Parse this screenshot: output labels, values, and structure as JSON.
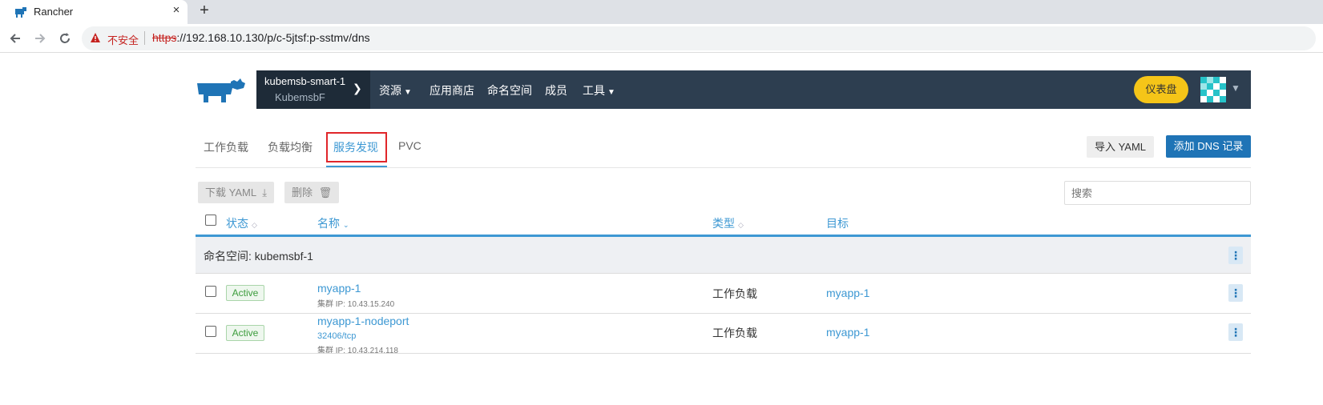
{
  "browser": {
    "tab_title": "Rancher",
    "tab_close": "×",
    "new_tab": "+",
    "insecure_label": "不安全",
    "url_scheme": "https",
    "url_rest": "://192.168.10.130/p/c-5jtsf:p-sstmv/dns"
  },
  "header": {
    "cluster_name": "kubemsb-smart-1",
    "project_name": "KubemsbF",
    "menu": [
      {
        "label": "资源",
        "has_dropdown": true
      },
      {
        "label": "应用商店",
        "has_dropdown": false
      },
      {
        "label": "命名空间",
        "has_dropdown": false
      },
      {
        "label": "成员",
        "has_dropdown": false
      },
      {
        "label": "工具",
        "has_dropdown": true
      }
    ],
    "dashboard_label": "仪表盘",
    "accent_color": "#f5c518",
    "bar_color": "#2d3e50"
  },
  "subnav": {
    "tabs": [
      {
        "label": "工作负载",
        "active": false
      },
      {
        "label": "负载均衡",
        "active": false
      },
      {
        "label": "服务发现",
        "active": true
      },
      {
        "label": "PVC",
        "active": false
      }
    ],
    "import_label": "导入 YAML",
    "add_label": "添加 DNS 记录"
  },
  "toolbar": {
    "download_label": "下载 YAML",
    "delete_label": "删除",
    "search_placeholder": "搜索"
  },
  "table": {
    "columns": {
      "state": "状态",
      "name": "名称",
      "type": "类型",
      "target": "目标"
    },
    "group_label": "命名空间: kubemsbf-1",
    "rows": [
      {
        "state": "Active",
        "name": "myapp-1",
        "port": "",
        "cluster_ip": "集群 IP: 10.43.15.240",
        "type": "工作负载",
        "target": "myapp-1"
      },
      {
        "state": "Active",
        "name": "myapp-1-nodeport",
        "port": "32406/tcp",
        "cluster_ip": "集群 IP: 10.43.214.118",
        "type": "工作负载",
        "target": "myapp-1"
      }
    ]
  }
}
